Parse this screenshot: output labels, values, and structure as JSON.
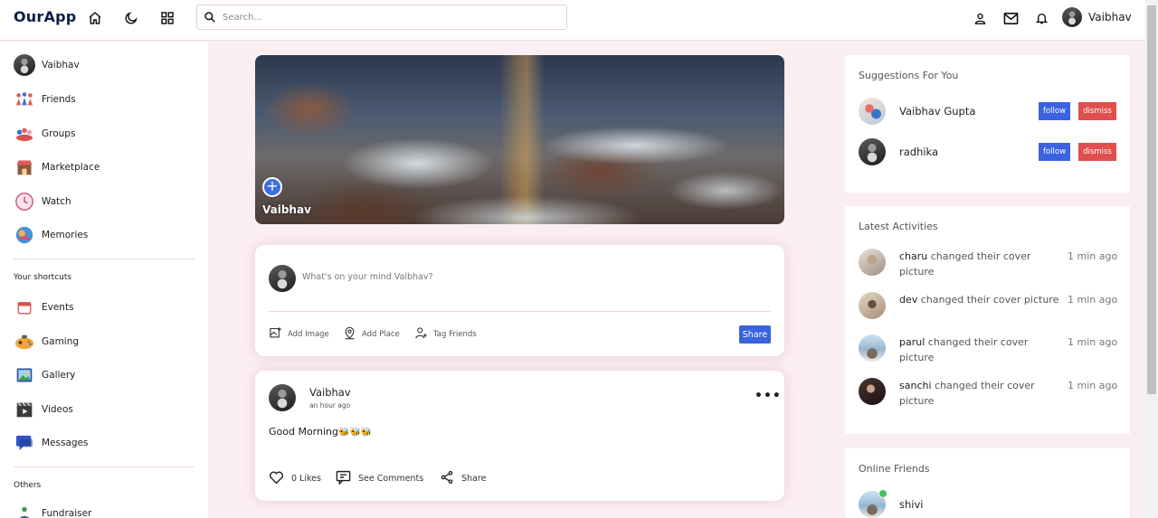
{
  "app": {
    "name": "OurApp"
  },
  "header": {
    "search_placeholder": "Search...",
    "user_name": "Vaibhav",
    "icons": [
      "home-icon",
      "moon-icon",
      "apps-grid-icon",
      "person-icon",
      "mail-icon",
      "bell-icon"
    ]
  },
  "sidebar": {
    "profile": {
      "label": "Vaibhav"
    },
    "items": [
      {
        "label": "Friends",
        "icon": "friends-icon"
      },
      {
        "label": "Groups",
        "icon": "groups-icon"
      },
      {
        "label": "Marketplace",
        "icon": "marketplace-icon"
      },
      {
        "label": "Watch",
        "icon": "watch-icon"
      },
      {
        "label": "Memories",
        "icon": "memories-icon"
      }
    ],
    "shortcuts_heading": "Your shortcuts",
    "shortcuts": [
      {
        "label": "Events",
        "icon": "calendar-icon"
      },
      {
        "label": "Gaming",
        "icon": "gamepad-icon"
      },
      {
        "label": "Gallery",
        "icon": "gallery-icon"
      },
      {
        "label": "Videos",
        "icon": "video-icon"
      },
      {
        "label": "Messages",
        "icon": "messages-icon"
      }
    ],
    "others_heading": "Others",
    "others": [
      {
        "label": "Fundraiser",
        "icon": "fundraiser-icon"
      }
    ]
  },
  "cover": {
    "name": "Vaibhav",
    "add_icon": "plus-icon"
  },
  "composer": {
    "placeholder": "What's on your mind Vaibhav?",
    "add_image": "Add Image",
    "add_place": "Add Place",
    "tag_friends": "Tag Friends",
    "share": "Share"
  },
  "post": {
    "author": "Vaibhav",
    "time": "an hour ago",
    "text": "Good Morning",
    "emojis": "🐝🐝🐝",
    "likes": "0 Likes",
    "comments": "See Comments",
    "share": "Share"
  },
  "suggestions": {
    "title": "Suggestions For You",
    "follow": "follow",
    "dismiss": "dismiss",
    "people": [
      {
        "name": "Vaibhav Gupta"
      },
      {
        "name": "radhika"
      }
    ]
  },
  "activities": {
    "title": "Latest Activities",
    "items": [
      {
        "name": "charu",
        "text": " changed their cover picture",
        "time": "1 min ago"
      },
      {
        "name": "dev",
        "text": " changed their cover picture",
        "time": "1 min ago"
      },
      {
        "name": "parul",
        "text": " changed their cover picture",
        "time": "1 min ago"
      },
      {
        "name": "sanchi",
        "text": " changed their cover picture",
        "time": "1 min ago"
      }
    ]
  },
  "online": {
    "title": "Online Friends",
    "friends": [
      {
        "name": "shivi"
      }
    ]
  },
  "colors": {
    "accent": "#3a63e0",
    "danger": "#e04e4e",
    "background": "#fbeef3",
    "online": "#3ec45a"
  }
}
